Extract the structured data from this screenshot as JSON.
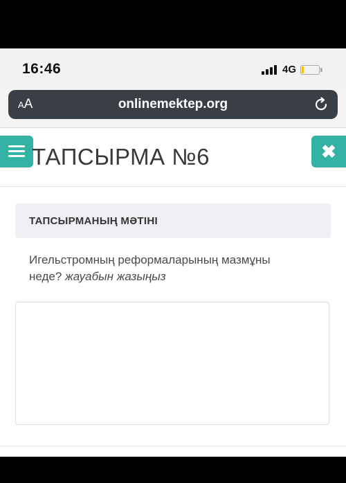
{
  "status_bar": {
    "time": "16:46",
    "network": "4G",
    "battery_level": 0.12
  },
  "browser": {
    "text_size_label_small": "A",
    "text_size_label_large": "A",
    "url": "onlinemektep.org",
    "reload_icon": "reload-icon"
  },
  "page": {
    "title": "ТАПСЫРМА №6",
    "menu_icon": "hamburger-icon",
    "close_icon": "close-icon",
    "close_glyph": "✖",
    "task_section_label": "ТАПСЫРМАНЫҢ МӘТІНІ",
    "question": "Игельстромның реформаларының мазмұны неде?",
    "instruction": "жауабын жазыңыз",
    "answer_value": ""
  },
  "colors": {
    "accent": "#34b3a4",
    "url_bar": "#3a3e45",
    "battery": "#f2c200"
  }
}
